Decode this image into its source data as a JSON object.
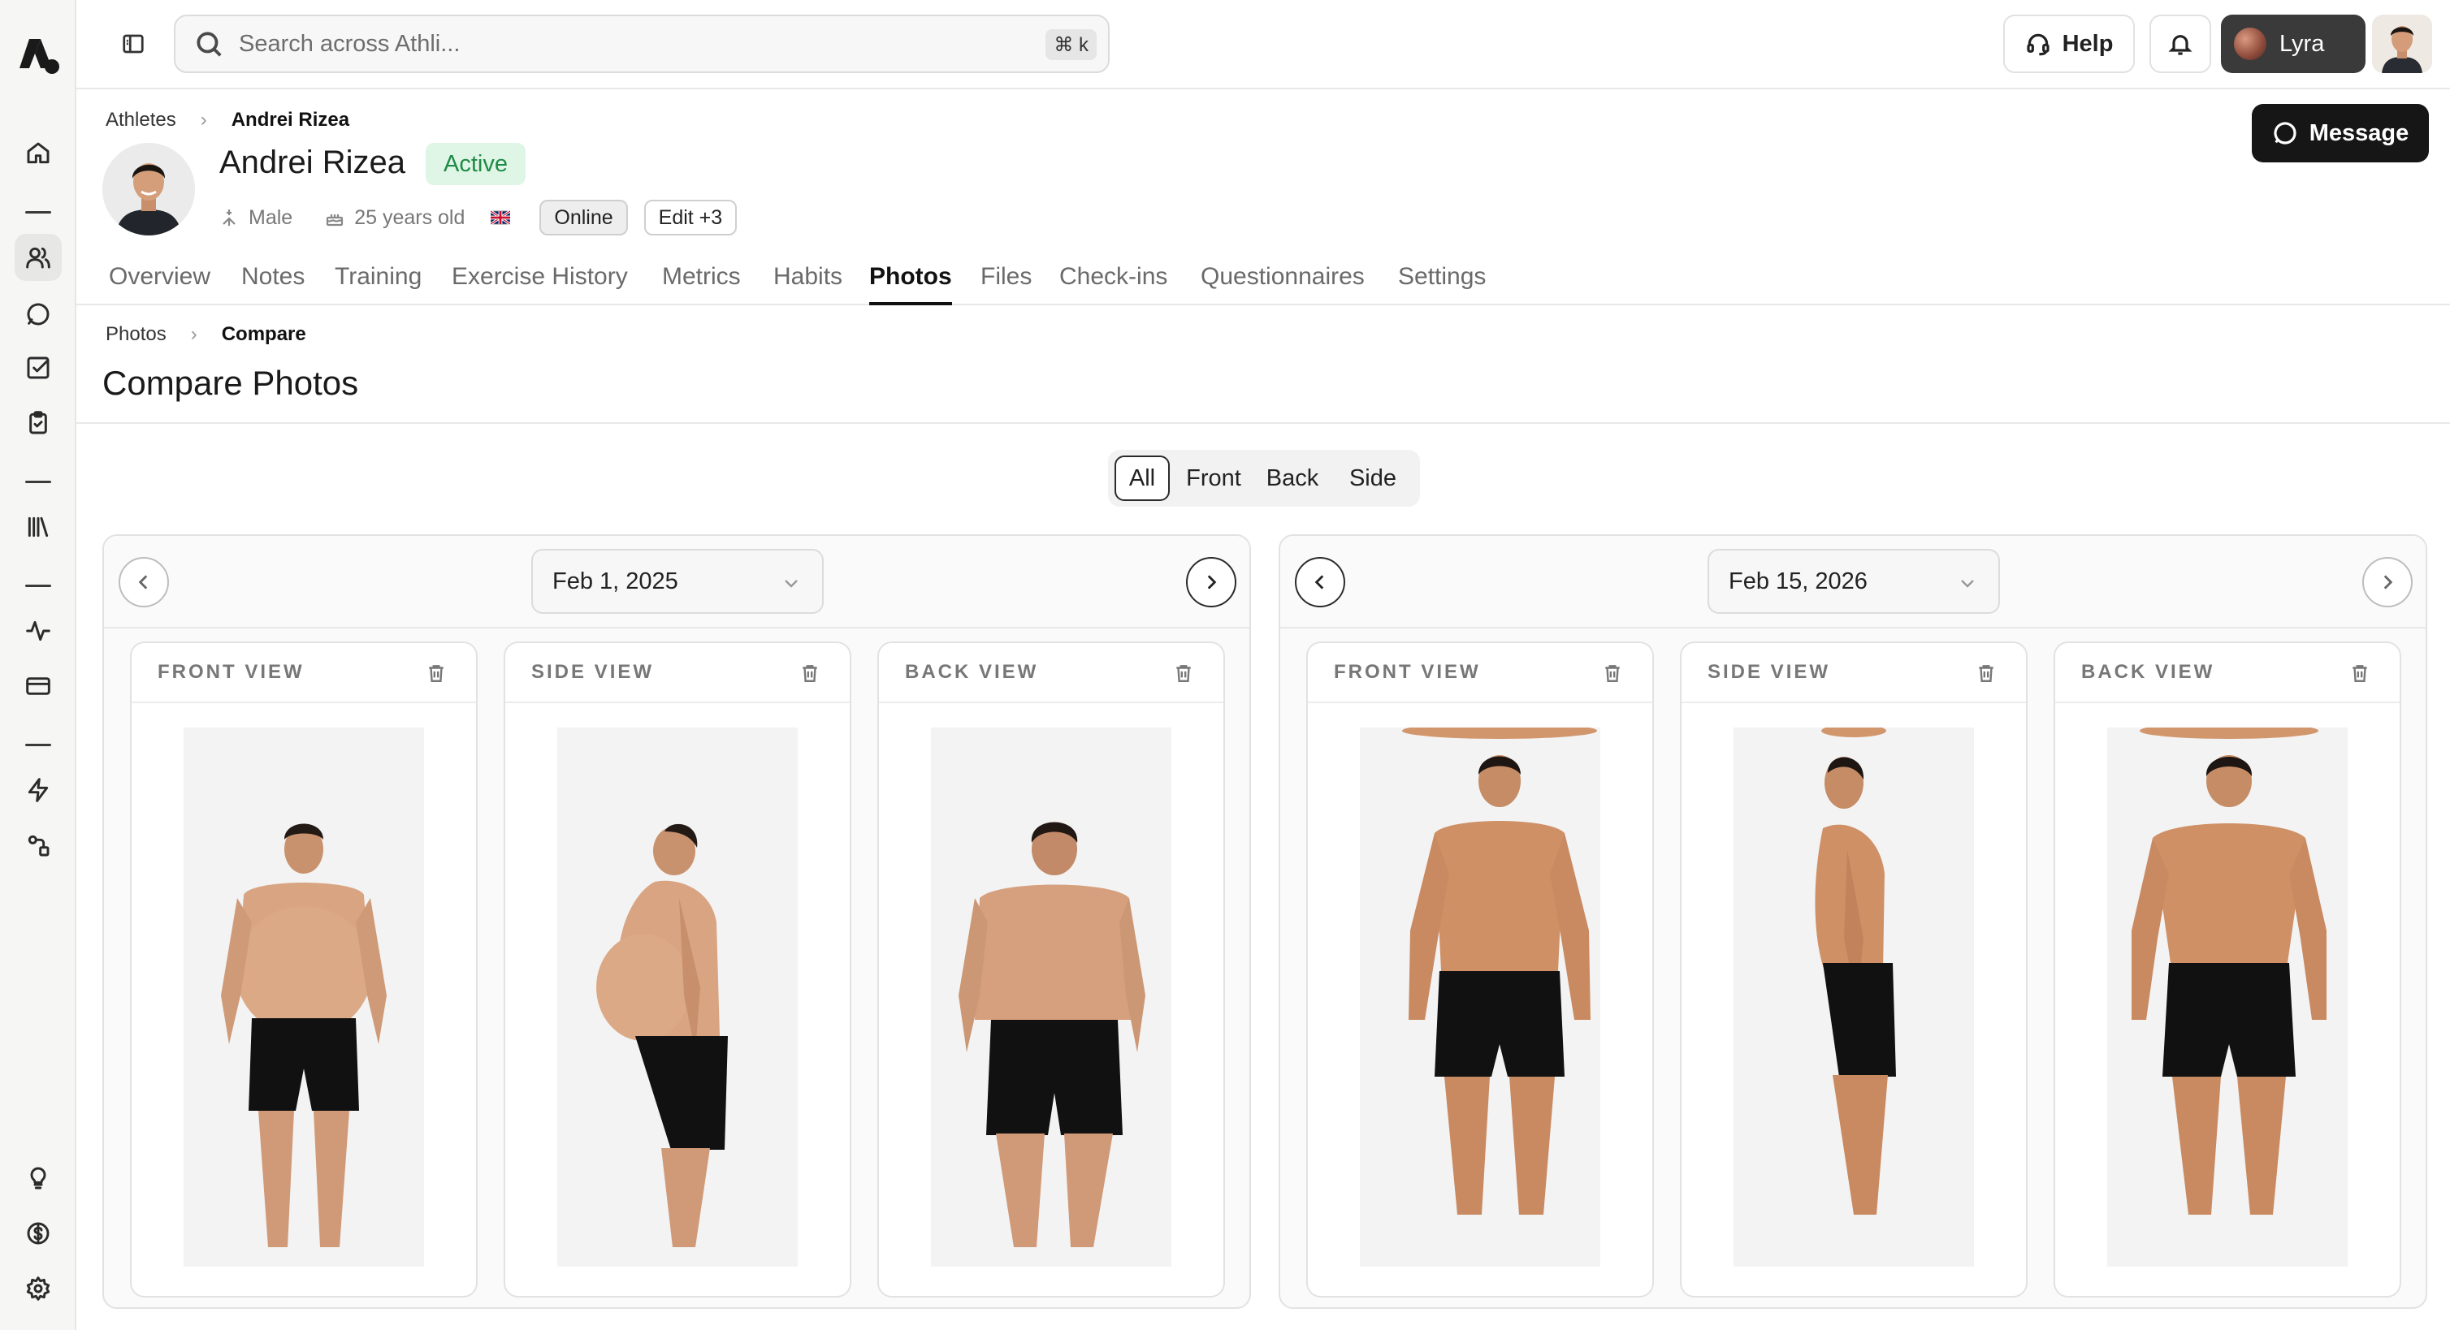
{
  "search": {
    "placeholder": "Search across Athli...",
    "shortcut": "⌘ k"
  },
  "topbar": {
    "help_label": "Help",
    "user_label": "Lyra"
  },
  "breadcrumb_top": {
    "root": "Athletes",
    "current": "Andrei Rizea"
  },
  "athlete": {
    "name": "Andrei Rizea",
    "status": "Active",
    "gender": "Male",
    "age": "25 years old",
    "country_flag": "uk-flag",
    "presence": "Online",
    "edit_label": "Edit +3",
    "message_label": "Message"
  },
  "tabs": [
    "Overview",
    "Notes",
    "Training",
    "Exercise History",
    "Metrics",
    "Habits",
    "Photos",
    "Files",
    "Check-ins",
    "Questionnaires",
    "Settings"
  ],
  "active_tab": "Photos",
  "breadcrumb_sub": {
    "root": "Photos",
    "current": "Compare"
  },
  "page_title": "Compare Photos",
  "filter": {
    "options": [
      "All",
      "Front",
      "Back",
      "Side"
    ],
    "selected": "All"
  },
  "compare": {
    "left": {
      "date": "Feb 1, 2025",
      "views": [
        {
          "label": "FRONT VIEW"
        },
        {
          "label": "SIDE VIEW"
        },
        {
          "label": "BACK VIEW"
        }
      ]
    },
    "right": {
      "date": "Feb 15, 2026",
      "views": [
        {
          "label": "FRONT VIEW"
        },
        {
          "label": "SIDE VIEW"
        },
        {
          "label": "BACK VIEW"
        }
      ]
    }
  },
  "colors": {
    "active_badge_bg": "#dff6e6",
    "active_badge_text": "#1f8a45",
    "primary_dark": "#161616"
  }
}
